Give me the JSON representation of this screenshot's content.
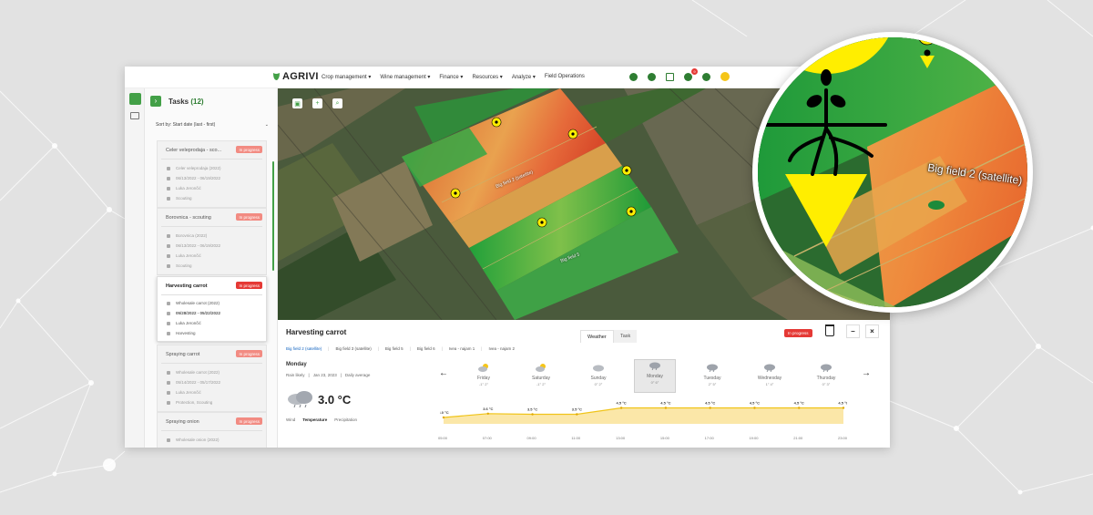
{
  "app": {
    "brand": "AGRIVI",
    "nav": [
      "Crop management ▾",
      "Wine management ▾",
      "Finance ▾",
      "Resources ▾",
      "Analyze ▾",
      "Field Operations"
    ],
    "notification_count": "9"
  },
  "tasks": {
    "title": "Tasks",
    "count": "(12)",
    "sort_label": "Sort by: Start date (last - first)",
    "items": [
      {
        "title": "Celer veleprodaja - sco...",
        "status": "In progress",
        "crop": "Celer veleprodaja (2022)",
        "dates": "06/13/2022 - 06/19/2022",
        "assignee": "Luka Jerončić",
        "type": "Scouting"
      },
      {
        "title": "Borovnica - scouting",
        "status": "In progress",
        "crop": "Borovnica (2022)",
        "dates": "06/13/2022 - 06/19/2022",
        "assignee": "Luka Jerončić",
        "type": "Scouting"
      },
      {
        "title": "Harvesting carrot",
        "status": "In progress",
        "crop": "Wholesale carrot (2022)",
        "dates": "05/28/2022 - 05/22/2022",
        "assignee": "Luka Jerončić",
        "type": "Harvesting"
      },
      {
        "title": "Spraying carrot",
        "status": "In progress",
        "crop": "Wholesale carrot (2022)",
        "dates": "05/14/2022 - 05/17/2022",
        "assignee": "Luka Jerončić",
        "type": "Protection, Scouting"
      },
      {
        "title": "Spraying onion",
        "status": "In progress",
        "crop": "Wholesale onion (2022)",
        "dates": "",
        "assignee": "",
        "type": ""
      }
    ]
  },
  "map": {
    "field_label_1": "Big field 2 (satellite)",
    "field_label_2": "Big field 5",
    "magnified_label": "Big field 2 (satellite)"
  },
  "details": {
    "title": "Harvesting carrot",
    "tabs": [
      "Weather",
      "Task"
    ],
    "status": "In progress",
    "fields": [
      "Big field 2 (satellite)",
      "Big field 3 (satellite)",
      "Big field 5",
      "Big field 6",
      "Ivea - najam 1",
      "Ivea - najam 2"
    ],
    "day_name": "Monday",
    "meta": [
      "Rain likely",
      "|",
      "Jan 23, 2023",
      "|",
      "Daily average"
    ],
    "temperature": "3.0 °C",
    "legend": [
      "Wind",
      "Temperature",
      "Precipitation"
    ],
    "days": [
      {
        "name": "Friday",
        "temps": "-1° 2°"
      },
      {
        "name": "Saturday",
        "temps": "-1° 2°"
      },
      {
        "name": "Sunday",
        "temps": "0° 2°"
      },
      {
        "name": "Monday",
        "temps": "0° 6°"
      },
      {
        "name": "Tuesday",
        "temps": "2° 5°"
      },
      {
        "name": "Wednesday",
        "temps": "1° 4°"
      },
      {
        "name": "Thursday",
        "temps": "0° 3°"
      }
    ],
    "hourly": {
      "hours": [
        "05:00",
        "07:00",
        "09:00",
        "11:00",
        "13:00",
        "15:00",
        "17:00",
        "19:00",
        "21:00",
        "23:00"
      ],
      "temp_labels": [
        "3.0 °C",
        "3.6 °C",
        "3.5 °C",
        "3.5 °C",
        "4.5 °C",
        "4.5 °C",
        "4.5 °C",
        "4.5 °C",
        "4.5 °C",
        "4.5 °C"
      ],
      "temps": [
        3.0,
        3.6,
        3.5,
        3.5,
        4.5,
        4.5,
        4.5,
        4.5,
        4.5,
        4.5
      ]
    }
  },
  "colors": {
    "brand_green": "#43a047",
    "status_red": "#e53935",
    "pin_yellow": "#ffee00"
  }
}
